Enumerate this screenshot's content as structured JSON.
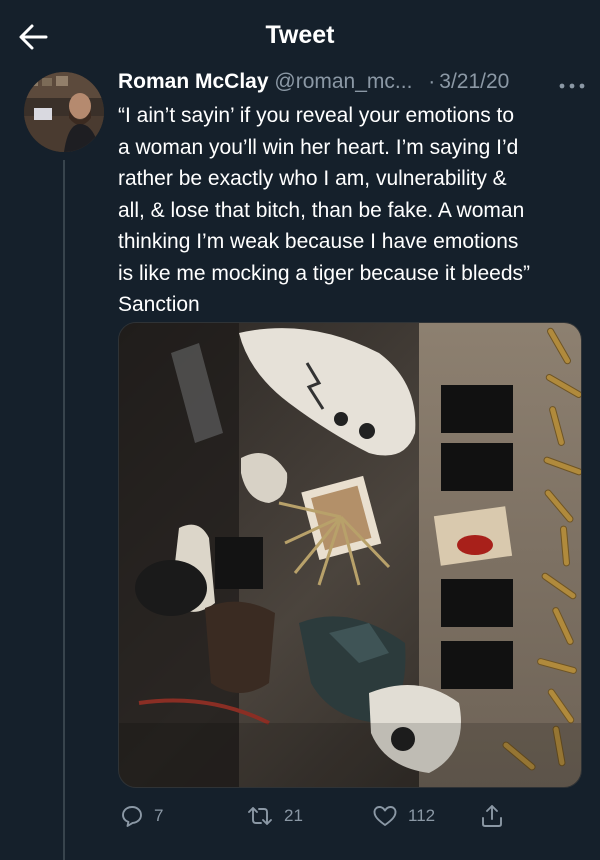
{
  "header": {
    "title": "Tweet"
  },
  "tweet": {
    "author_name": "Roman McClay",
    "author_handle": "@roman_mc...",
    "date": "3/21/20",
    "text": "“I ain’t sayin’ if you reveal your emotions to\na woman you’ll win her heart. I’m saying I’d\nrather be exactly who I am, vulnerability &\nall, & lose that bitch, than be fake. A woman\nthinking I’m weak because I have emotions\nis like me mocking a tiger because it bleeds”\nSanction"
  },
  "actions": {
    "replies": "7",
    "retweets": "21",
    "likes": "112"
  },
  "icons": {
    "back": "arrow-left-icon",
    "more": "more-horizontal-icon",
    "reply": "reply-bubble-icon",
    "retweet": "retweet-icon",
    "like": "heart-icon",
    "share": "share-icon"
  },
  "colors": {
    "background": "#15202b",
    "text": "#ffffff",
    "secondary_text": "#8b98a5",
    "divider": "#38444d"
  }
}
